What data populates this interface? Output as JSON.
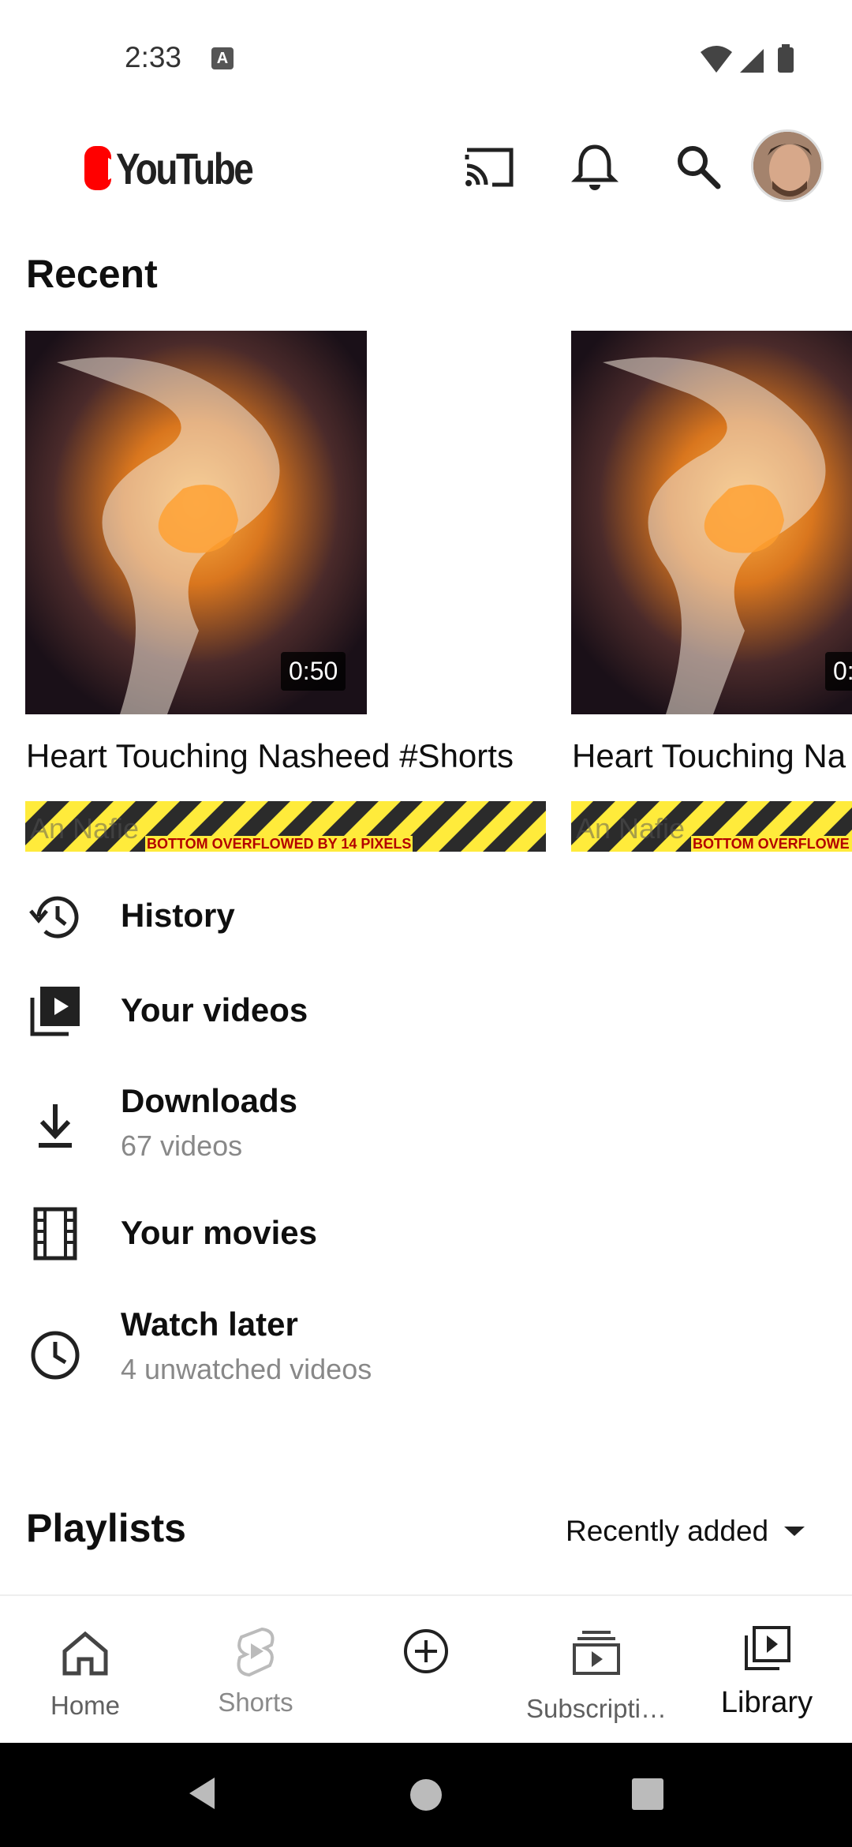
{
  "status_bar": {
    "time": "2:33",
    "notif_glyph": "A"
  },
  "header": {
    "logo_text": "YouTube"
  },
  "recent": {
    "title": "Recent",
    "videos": [
      {
        "title": "Heart Touching Nasheed #Shorts",
        "duration": "0:50",
        "channel_fragment": "An Nafie",
        "overflow_msg": "BOTTOM OVERFLOWED BY 14 PIXELS"
      },
      {
        "title": "Heart Touching Na",
        "duration": "0:",
        "channel_fragment": "An Nafie",
        "overflow_msg": "BOTTOM OVERFLOWE"
      }
    ]
  },
  "library_menu": [
    {
      "label": "History",
      "icon": "history-icon"
    },
    {
      "label": "Your videos",
      "icon": "your-videos-icon"
    },
    {
      "label": "Downloads",
      "sub": "67 videos",
      "icon": "download-icon"
    },
    {
      "label": "Your movies",
      "icon": "movies-icon"
    },
    {
      "label": "Watch later",
      "sub": "4 unwatched videos",
      "icon": "clock-icon"
    }
  ],
  "playlists": {
    "title": "Playlists",
    "sort_label": "Recently added"
  },
  "bottom_nav": {
    "items": [
      {
        "label": "Home",
        "icon": "home-icon"
      },
      {
        "label": "Shorts",
        "icon": "shorts-icon"
      },
      {
        "label": "",
        "icon": "create-icon"
      },
      {
        "label": "Subscripti…",
        "icon": "subscriptions-icon"
      },
      {
        "label": "Library",
        "icon": "library-icon",
        "active": true
      }
    ]
  },
  "colors": {
    "brand_red": "#ff0000",
    "overflow_yellow": "#ffeb3b",
    "overflow_dark": "#2b2b2b"
  }
}
